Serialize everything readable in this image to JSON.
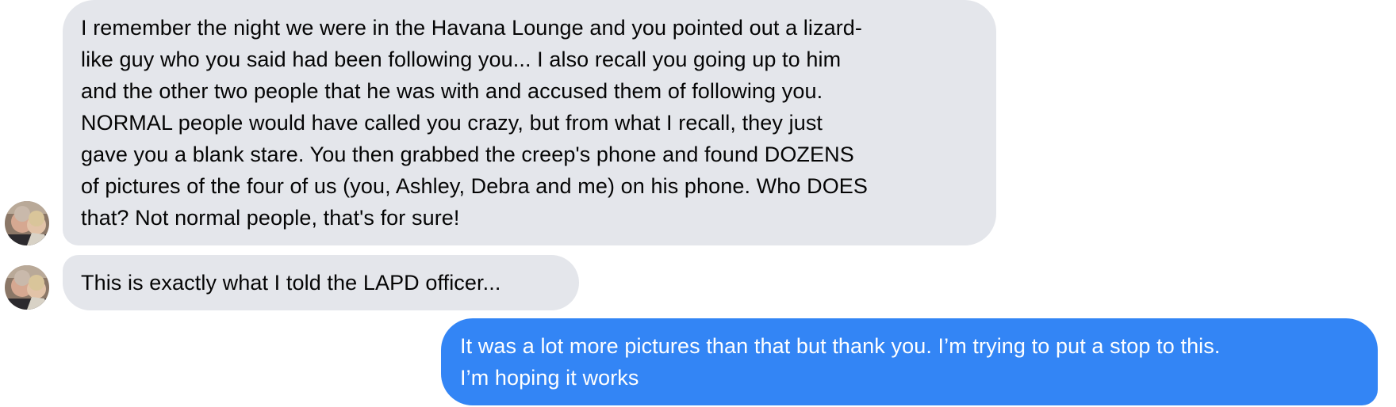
{
  "conversation": {
    "messages": [
      {
        "direction": "incoming",
        "lines": [
          "I remember the night we were in the Havana Lounge and you pointed out a lizard-",
          "like guy who you said had been following you... I also recall you going up to him",
          "and the other two people that he was with and accused them of following you.",
          "NORMAL people would have called you crazy, but from what I recall, they just",
          "gave you a blank stare. You then grabbed the creep's phone and found DOZENS",
          "of pictures of the four of us (you, Ashley, Debra and me) on his phone. Who DOES",
          "that? Not normal people, that's for sure!"
        ]
      },
      {
        "direction": "incoming",
        "lines": [
          "This is exactly what I told the LAPD officer..."
        ]
      },
      {
        "direction": "outgoing",
        "lines": [
          "It was a lot more pictures than that but thank you. I’m trying to put a stop to this.",
          "I’m hoping it works"
        ]
      }
    ]
  },
  "colors": {
    "incoming_bubble": "#e4e6eb",
    "incoming_text": "#050505",
    "outgoing_bubble": "#3385f5",
    "outgoing_text": "#ffffff"
  }
}
